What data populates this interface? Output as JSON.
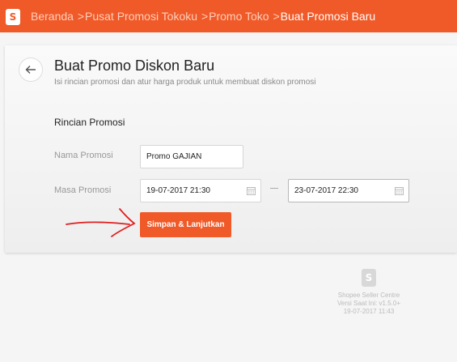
{
  "breadcrumb": {
    "items": [
      "Beranda",
      "Pusat Promosi Tokoku",
      "Promo Toko",
      "Buat Promosi Baru"
    ],
    "separator": ">"
  },
  "page": {
    "title": "Buat Promo Diskon Baru",
    "subtitle": "Isi rincian promosi dan atur harga produk untuk membuat diskon promosi"
  },
  "form": {
    "section_title": "Rincian Promosi",
    "name_label": "Nama Promosi",
    "name_value": "Promo GAJIAN",
    "period_label": "Masa Promosi",
    "start_value": "19-07-2017 21:30",
    "end_value": "23-07-2017 22:30",
    "save_label": "Simpan & Lanjutkan"
  },
  "footer": {
    "line1": "Shopee Seller Centre",
    "line2": "Versi Saat Ini: v1.5.0+",
    "line3": "19-07-2017 11:43"
  },
  "colors": {
    "brand": "#f05a28",
    "annotation": "#e02020"
  },
  "icons": [
    "shopee-logo-icon",
    "back-arrow-icon",
    "calendar-icon",
    "hand-drawn-arrow"
  ]
}
